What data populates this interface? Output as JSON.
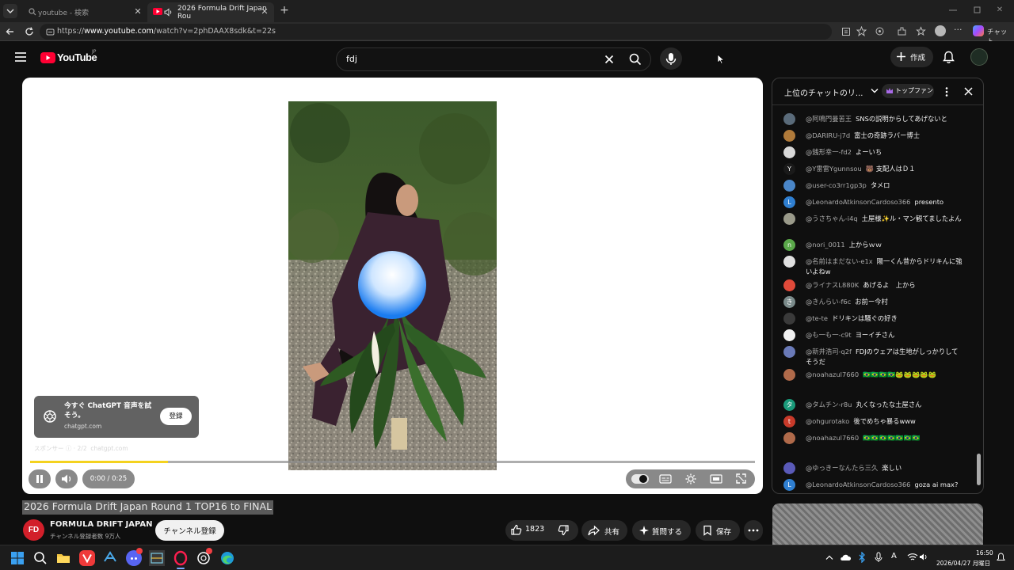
{
  "browser": {
    "tabs": [
      {
        "label": "youtube - 検索",
        "active": false
      },
      {
        "label": "2026 Formula Drift Japan Rou",
        "active": true
      }
    ],
    "url_prefix": "https://",
    "url_host": "www.youtube.com",
    "url_path": "/watch?v=2phDAAX8sdk&t=22s",
    "chat_label": "チャット"
  },
  "header": {
    "logo_text": "YouTube",
    "logo_region": "JP",
    "search_value": "fdj",
    "create_label": "作成"
  },
  "player": {
    "time": "0:00 / 0:25",
    "progress": 0.19,
    "ad": {
      "title": "今すぐ ChatGPT 音声を試そう。",
      "domain": "chatgpt.com",
      "button": "登録",
      "sponsor": "スポンサー ⓘ · 2/2",
      "sponsor_domain": "chatgpt.com"
    }
  },
  "video": {
    "title": "2026 Formula Drift Japan Round 1 TOP16 to FINAL",
    "channel": "FORMULA DRIFT JAPAN",
    "channel_badge": "FD",
    "subscribers": "チャンネル登録者数 9万人",
    "subscribe_label": "チャンネル登録",
    "likes": "1823",
    "share_label": "共有",
    "ask_label": "質問する",
    "save_label": "保存"
  },
  "chat": {
    "title": "上位のチャットのリ...",
    "top_fan": "トップファン",
    "messages": [
      {
        "author": "@阿鳴門曼苦王",
        "text": "SNSの説明からしてあげないと",
        "color": "#5a6b7a",
        "initial": ""
      },
      {
        "author": "@DARIRU-j7d",
        "text": "富士の奇跡ラバー博士",
        "color": "#b07a3a",
        "initial": ""
      },
      {
        "author": "@銭形幸一-fd2",
        "text": "よーいち",
        "color": "#d8d8d8",
        "initial": ""
      },
      {
        "author": "@Y雷雷Ygunnsou",
        "text": "🐻 支配人はＤ１",
        "color": "#1a1a1a",
        "initial": "Y"
      },
      {
        "author": "@user-co3rr1gp3p",
        "text": "タメロ",
        "color": "#4a86c8",
        "initial": ""
      },
      {
        "author": "@LeonardoAtkinsonCardoso366",
        "text": "presento",
        "color": "#2f7fd1",
        "initial": "L"
      },
      {
        "author": "@うさちゃん-i4q",
        "text": "土屋様✨ル・マン観てましたよん",
        "color": "#9a9a8a",
        "initial": ""
      },
      {
        "author": "@nori_0011",
        "text": "上からｗｗ",
        "color": "#5aa84a",
        "initial": "n"
      },
      {
        "author": "@名前はまだない-e1x",
        "text": "陽一くん昔からドリキんに強いよねw",
        "color": "#e0e0e0",
        "initial": ""
      },
      {
        "author": "@ライナスL880K",
        "text": "あげるよ　上から",
        "color": "#e04a3a",
        "initial": ""
      },
      {
        "author": "@きんらい-f6c",
        "text": "お前ー今村",
        "color": "#7a8a8a",
        "initial": "き"
      },
      {
        "author": "@te-te",
        "text": "ドリキンは騒ぐの好き",
        "color": "#3a3a3a",
        "initial": ""
      },
      {
        "author": "@も一も一-c9t",
        "text": "ヨーイチさん",
        "color": "#f0f0f0",
        "initial": ""
      },
      {
        "author": "@新井浩司-q2f",
        "text": "FDJのウェアは生地がしっかりしてそうだ",
        "color": "#6a7ab8",
        "initial": ""
      },
      {
        "author": "@noahazul7660",
        "text": "🇧🇷🇧🇷🇧🇷🇧🇷🐸🐸🐸🐸🐸",
        "color": "#b06a4a",
        "initial": ""
      },
      {
        "author": "@タムチン-r8u",
        "text": "丸くなったな土屋さん",
        "color": "#1a9a7a",
        "initial": "タ"
      },
      {
        "author": "@ohgurotako",
        "text": "後でめちゃ暴るwww",
        "color": "#c83a2a",
        "initial": "t"
      },
      {
        "author": "@noahazul7660",
        "text": "🇧🇷🇧🇷🇧🇷🇧🇷🇧🇷🇧🇷🇧🇷",
        "color": "#b06a4a",
        "initial": ""
      },
      {
        "author": "@ゆっきーなんたら三久",
        "text": "楽しい",
        "color": "#5a5ab8",
        "initial": ""
      },
      {
        "author": "@LeonardoAtkinsonCardoso366",
        "text": "goza ai max?",
        "color": "#2f7fd1",
        "initial": "L"
      }
    ]
  },
  "taskbar": {
    "time": "16:50",
    "date": "2026/04/27 月曜日",
    "ime": "A"
  }
}
